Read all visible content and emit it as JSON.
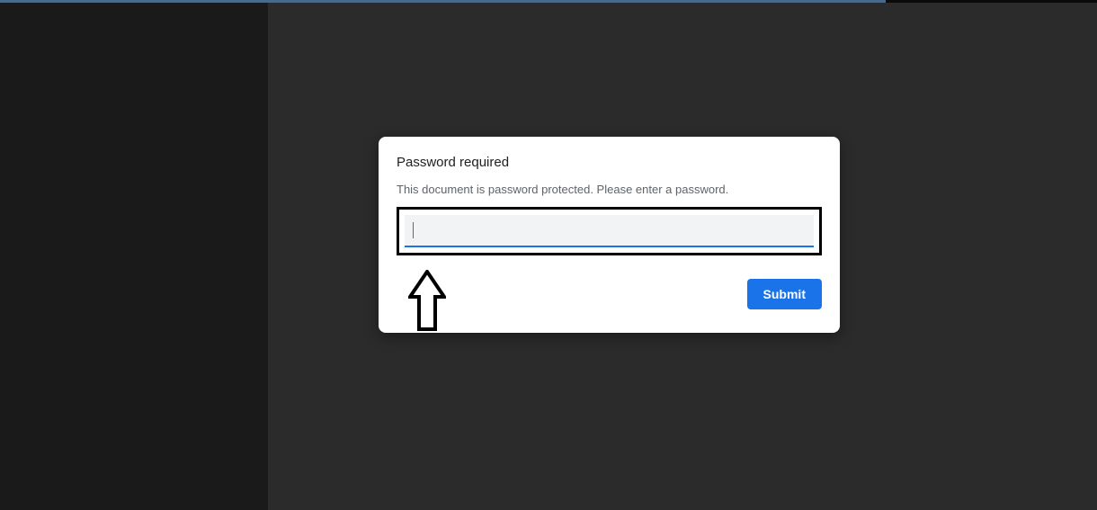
{
  "dialog": {
    "title": "Password required",
    "subtitle": "This document is password protected. Please enter a password.",
    "submit_label": "Submit"
  }
}
